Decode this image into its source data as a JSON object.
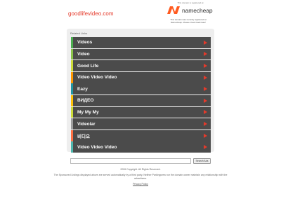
{
  "header": {
    "domain": "goodlifevideo.com",
    "registrar_notice": "This domain is registered at",
    "registrar_name": "namecheap",
    "registrar_sub": "This domain was recently registered at Namecheap. Please check back later!"
  },
  "related_links": {
    "title": "Related Links",
    "items": [
      {
        "label": "Videos",
        "accent": "#4caf50"
      },
      {
        "label": "Video",
        "accent": "#8bc34a"
      },
      {
        "label": "Good Life",
        "accent": "#cddc39"
      },
      {
        "label": "Video Video Video",
        "accent": "#ff9800"
      },
      {
        "label": "Eazy",
        "accent": "#2196a3"
      },
      {
        "label": "ВИДЕО",
        "accent": "#ffc107"
      },
      {
        "label": "My My My",
        "accent": "#cddc39"
      },
      {
        "label": "Videolar",
        "accent": "#9e9e9e"
      },
      {
        "label": "비디오",
        "accent": "#ff7043"
      },
      {
        "label": "Video Video Video",
        "accent": "#4db6ac"
      }
    ]
  },
  "search": {
    "placeholder": "",
    "button_label": "Search Ads"
  },
  "footer": {
    "copyright": "2026 Copyright. All Rights Reserved.",
    "disclaimer": "The Sponsored Listings displayed above are served automatically by a third party. Neither Parkingcrew nor the domain owner maintain any relationship with the advertisers.",
    "privacy": "Privacy Policy"
  },
  "colors": {
    "accent_red": "#e53a2b",
    "item_bg": "#4b4b4b",
    "nc_orange": "#ff5a1f"
  }
}
